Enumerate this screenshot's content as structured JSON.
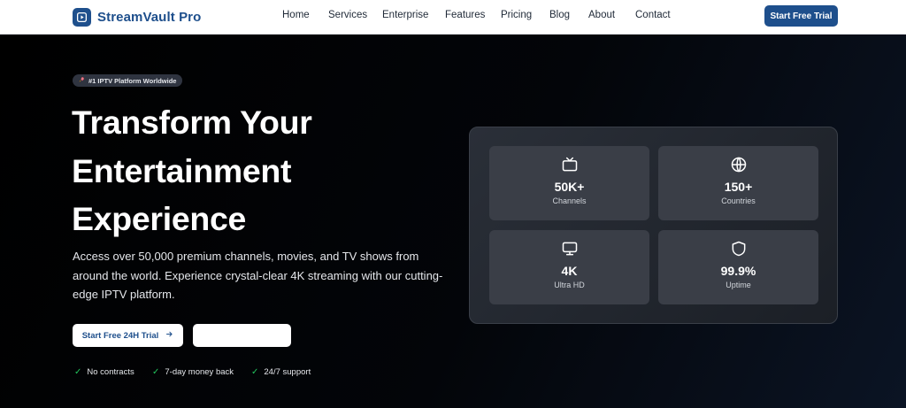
{
  "brand": {
    "name": "StreamVault Pro",
    "icon": "play-logo-icon",
    "color": "#1e4f8c"
  },
  "nav": {
    "links": [
      "Home",
      "Services",
      "Enterprise",
      "Features",
      "Pricing",
      "Blog",
      "About",
      "Contact"
    ],
    "cta": "Start Free Trial"
  },
  "hero": {
    "badge": "#1 IPTV Platform Worldwide",
    "badge_icon": "rocket-icon",
    "headline": [
      "Transform Your",
      "Entertainment",
      "Experience"
    ],
    "subtitle": "Access over 50,000 premium channels, movies, and TV shows from around the world. Experience crystal-clear 4K streaming with our cutting-edge IPTV platform.",
    "primary_button": "Start Free 24H Trial",
    "secondary_button": "",
    "checks": [
      "No contracts",
      "7-day money back",
      "24/7 support"
    ]
  },
  "stats": [
    {
      "icon": "tv-icon",
      "value": "50K+",
      "label": "Channels"
    },
    {
      "icon": "globe-icon",
      "value": "150+",
      "label": "Countries"
    },
    {
      "icon": "monitor-icon",
      "value": "4K",
      "label": "Ultra HD"
    },
    {
      "icon": "shield-icon",
      "value": "99.9%",
      "label": "Uptime"
    }
  ],
  "colors": {
    "accent": "#1e4f8c",
    "check": "#22c55e",
    "hero_bg": "#000000"
  }
}
